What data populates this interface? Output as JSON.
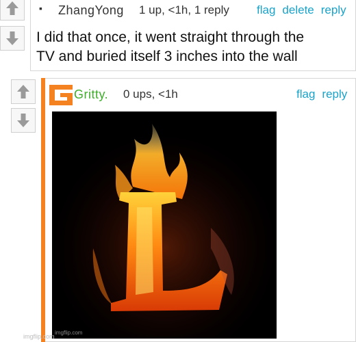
{
  "comment1": {
    "bullet": "▪",
    "username": "ZhangYong",
    "meta": "1 up, <1h, 1 reply",
    "actions": {
      "flag": "flag",
      "delete": "delete",
      "reply": "reply"
    },
    "text_line1": "I did that once, it went straight through the",
    "text_line2": "TV and buried itself 3 inches into the wall"
  },
  "comment2": {
    "username": "Gritty.",
    "meta": "0 ups, <1h",
    "actions": {
      "flag": "flag",
      "reply": "reply"
    },
    "image_watermark": "imgflip.com"
  },
  "page_watermark": "imgflip.com",
  "colors": {
    "link": "#19a3c9",
    "username_green": "#3fae2a",
    "orange_accent": "#f58220"
  },
  "icons": [
    "up-arrow-icon",
    "down-arrow-icon",
    "gritty-logo-icon",
    "flaming-letter-l-image"
  ]
}
